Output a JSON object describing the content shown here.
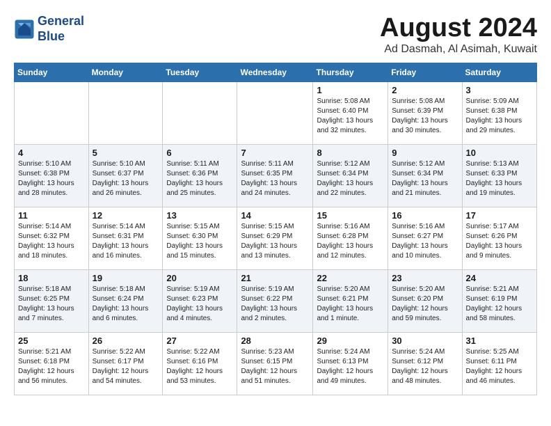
{
  "logo": {
    "line1": "General",
    "line2": "Blue"
  },
  "title": "August 2024",
  "location": "Ad Dasmah, Al Asimah, Kuwait",
  "weekdays": [
    "Sunday",
    "Monday",
    "Tuesday",
    "Wednesday",
    "Thursday",
    "Friday",
    "Saturday"
  ],
  "weeks": [
    [
      {
        "day": "",
        "info": ""
      },
      {
        "day": "",
        "info": ""
      },
      {
        "day": "",
        "info": ""
      },
      {
        "day": "",
        "info": ""
      },
      {
        "day": "1",
        "info": "Sunrise: 5:08 AM\nSunset: 6:40 PM\nDaylight: 13 hours\nand 32 minutes."
      },
      {
        "day": "2",
        "info": "Sunrise: 5:08 AM\nSunset: 6:39 PM\nDaylight: 13 hours\nand 30 minutes."
      },
      {
        "day": "3",
        "info": "Sunrise: 5:09 AM\nSunset: 6:38 PM\nDaylight: 13 hours\nand 29 minutes."
      }
    ],
    [
      {
        "day": "4",
        "info": "Sunrise: 5:10 AM\nSunset: 6:38 PM\nDaylight: 13 hours\nand 28 minutes."
      },
      {
        "day": "5",
        "info": "Sunrise: 5:10 AM\nSunset: 6:37 PM\nDaylight: 13 hours\nand 26 minutes."
      },
      {
        "day": "6",
        "info": "Sunrise: 5:11 AM\nSunset: 6:36 PM\nDaylight: 13 hours\nand 25 minutes."
      },
      {
        "day": "7",
        "info": "Sunrise: 5:11 AM\nSunset: 6:35 PM\nDaylight: 13 hours\nand 24 minutes."
      },
      {
        "day": "8",
        "info": "Sunrise: 5:12 AM\nSunset: 6:34 PM\nDaylight: 13 hours\nand 22 minutes."
      },
      {
        "day": "9",
        "info": "Sunrise: 5:12 AM\nSunset: 6:34 PM\nDaylight: 13 hours\nand 21 minutes."
      },
      {
        "day": "10",
        "info": "Sunrise: 5:13 AM\nSunset: 6:33 PM\nDaylight: 13 hours\nand 19 minutes."
      }
    ],
    [
      {
        "day": "11",
        "info": "Sunrise: 5:14 AM\nSunset: 6:32 PM\nDaylight: 13 hours\nand 18 minutes."
      },
      {
        "day": "12",
        "info": "Sunrise: 5:14 AM\nSunset: 6:31 PM\nDaylight: 13 hours\nand 16 minutes."
      },
      {
        "day": "13",
        "info": "Sunrise: 5:15 AM\nSunset: 6:30 PM\nDaylight: 13 hours\nand 15 minutes."
      },
      {
        "day": "14",
        "info": "Sunrise: 5:15 AM\nSunset: 6:29 PM\nDaylight: 13 hours\nand 13 minutes."
      },
      {
        "day": "15",
        "info": "Sunrise: 5:16 AM\nSunset: 6:28 PM\nDaylight: 13 hours\nand 12 minutes."
      },
      {
        "day": "16",
        "info": "Sunrise: 5:16 AM\nSunset: 6:27 PM\nDaylight: 13 hours\nand 10 minutes."
      },
      {
        "day": "17",
        "info": "Sunrise: 5:17 AM\nSunset: 6:26 PM\nDaylight: 13 hours\nand 9 minutes."
      }
    ],
    [
      {
        "day": "18",
        "info": "Sunrise: 5:18 AM\nSunset: 6:25 PM\nDaylight: 13 hours\nand 7 minutes."
      },
      {
        "day": "19",
        "info": "Sunrise: 5:18 AM\nSunset: 6:24 PM\nDaylight: 13 hours\nand 6 minutes."
      },
      {
        "day": "20",
        "info": "Sunrise: 5:19 AM\nSunset: 6:23 PM\nDaylight: 13 hours\nand 4 minutes."
      },
      {
        "day": "21",
        "info": "Sunrise: 5:19 AM\nSunset: 6:22 PM\nDaylight: 13 hours\nand 2 minutes."
      },
      {
        "day": "22",
        "info": "Sunrise: 5:20 AM\nSunset: 6:21 PM\nDaylight: 13 hours\nand 1 minute."
      },
      {
        "day": "23",
        "info": "Sunrise: 5:20 AM\nSunset: 6:20 PM\nDaylight: 12 hours\nand 59 minutes."
      },
      {
        "day": "24",
        "info": "Sunrise: 5:21 AM\nSunset: 6:19 PM\nDaylight: 12 hours\nand 58 minutes."
      }
    ],
    [
      {
        "day": "25",
        "info": "Sunrise: 5:21 AM\nSunset: 6:18 PM\nDaylight: 12 hours\nand 56 minutes."
      },
      {
        "day": "26",
        "info": "Sunrise: 5:22 AM\nSunset: 6:17 PM\nDaylight: 12 hours\nand 54 minutes."
      },
      {
        "day": "27",
        "info": "Sunrise: 5:22 AM\nSunset: 6:16 PM\nDaylight: 12 hours\nand 53 minutes."
      },
      {
        "day": "28",
        "info": "Sunrise: 5:23 AM\nSunset: 6:15 PM\nDaylight: 12 hours\nand 51 minutes."
      },
      {
        "day": "29",
        "info": "Sunrise: 5:24 AM\nSunset: 6:13 PM\nDaylight: 12 hours\nand 49 minutes."
      },
      {
        "day": "30",
        "info": "Sunrise: 5:24 AM\nSunset: 6:12 PM\nDaylight: 12 hours\nand 48 minutes."
      },
      {
        "day": "31",
        "info": "Sunrise: 5:25 AM\nSunset: 6:11 PM\nDaylight: 12 hours\nand 46 minutes."
      }
    ]
  ]
}
